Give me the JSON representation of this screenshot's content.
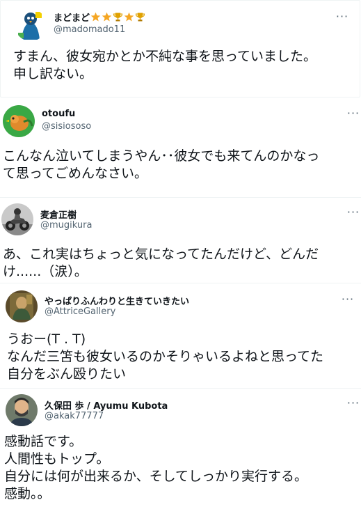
{
  "tweets": [
    {
      "name": "まどまど",
      "handle": "@madomado11",
      "badges": [
        "star-icon",
        "star-icon",
        "trophy-icon",
        "star-icon",
        "trophy-icon"
      ],
      "lines": [
        "すまん、彼女宛かとか不純な事を思っていました。",
        "申し訳ない。"
      ]
    },
    {
      "name": "otoufu",
      "handle": "@sisiososo",
      "lines": [
        "こんなん泣いてしまうやん･･彼女でも来てんのかなっ",
        "て思ってごめんなさい。"
      ]
    },
    {
      "name": "麦倉正樹",
      "handle": "@mugikura",
      "lines": [
        "あ、これ実はちょっと気になってたんだけど、どんだ",
        "け......（涙）。"
      ]
    },
    {
      "name": "やっぱりふんわりと生きていきたい",
      "handle": "@AttriceGallery",
      "lines": [
        "うおー(T . T)",
        "なんだ三笘も彼女いるのかそりゃいるよねと思ってた",
        "自分をぶん殴りたい"
      ]
    },
    {
      "name": "久保田 歩 / Ayumu Kubota",
      "handle": "@akak77777",
      "lines": [
        "感動話です。",
        "人間性もトップ。",
        "自分には何が出来るか、そしてしっかり実行する。",
        "感動。。"
      ]
    }
  ],
  "more_label": "···",
  "colors": {
    "star": "#f5a623",
    "trophy": "#e0a100",
    "handle": "#536471"
  }
}
